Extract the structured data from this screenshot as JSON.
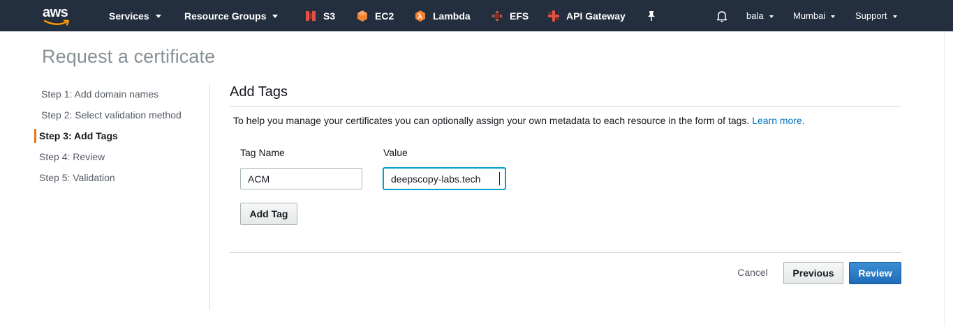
{
  "nav": {
    "logo_text": "aws",
    "services_label": "Services",
    "resource_groups_label": "Resource Groups",
    "shortcuts": [
      {
        "label": "S3",
        "icon": "s3-icon",
        "color": "#e05243"
      },
      {
        "label": "EC2",
        "icon": "ec2-icon",
        "color": "#f58536"
      },
      {
        "label": "Lambda",
        "icon": "lambda-icon",
        "color": "#f58536"
      },
      {
        "label": "EFS",
        "icon": "efs-icon",
        "color": "#e05243"
      },
      {
        "label": "API Gateway",
        "icon": "api-gateway-icon",
        "color": "#e05243"
      }
    ],
    "user_label": "bala",
    "region_label": "Mumbai",
    "support_label": "Support"
  },
  "page": {
    "title": "Request a certificate"
  },
  "steps": [
    {
      "label": "Step 1: Add domain names",
      "state": "done"
    },
    {
      "label": "Step 2: Select validation method",
      "state": "done"
    },
    {
      "label": "Step 3: Add Tags",
      "state": "active"
    },
    {
      "label": "Step 4: Review",
      "state": "todo"
    },
    {
      "label": "Step 5: Validation",
      "state": "todo"
    }
  ],
  "main": {
    "section_title": "Add Tags",
    "description": "To help you manage your certificates you can optionally assign your own metadata to each resource in the form of tags.",
    "learn_more": "Learn more.",
    "tag_name_label": "Tag Name",
    "value_label": "Value",
    "tag_name_value": "ACM",
    "tag_value_value": "deepscopy-labs.tech",
    "add_tag_label": "Add Tag"
  },
  "footer": {
    "cancel_label": "Cancel",
    "previous_label": "Previous",
    "review_label": "Review"
  },
  "colors": {
    "nav_bg": "#232f3e",
    "accent_orange": "#ec7211",
    "primary_blue": "#1e6cb8",
    "link_blue": "#0073bb"
  }
}
